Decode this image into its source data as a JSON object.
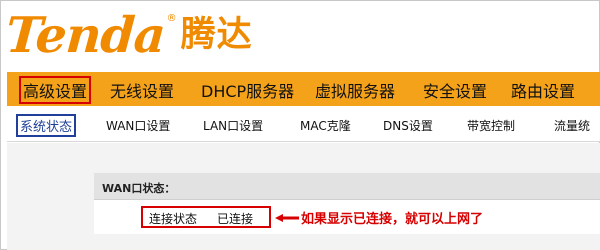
{
  "logo": {
    "brand_en": "Tenda",
    "registered": "®",
    "brand_cn": "腾达"
  },
  "main_nav": {
    "items": [
      {
        "label": "高级设置",
        "active": true
      },
      {
        "label": "无线设置",
        "active": false
      },
      {
        "label": "DHCP服务器",
        "active": false
      },
      {
        "label": "虚拟服务器",
        "active": false
      },
      {
        "label": "安全设置",
        "active": false
      },
      {
        "label": "路由设置",
        "active": false
      }
    ]
  },
  "sub_nav": {
    "items": [
      {
        "label": "系统状态",
        "active": true
      },
      {
        "label": "WAN口设置",
        "active": false
      },
      {
        "label": "LAN口设置",
        "active": false
      },
      {
        "label": "MAC克隆",
        "active": false
      },
      {
        "label": "DNS设置",
        "active": false
      },
      {
        "label": "带宽控制",
        "active": false
      },
      {
        "label": "流量统",
        "active": false
      }
    ]
  },
  "wan_status": {
    "title": "WAN口状态：",
    "connection_label": "连接状态",
    "connection_value": "已连接"
  },
  "annotation": {
    "text": "如果显示已连接，就可以上网了"
  },
  "colors": {
    "brand_orange": "#f08a00",
    "nav_orange": "#f5a21b",
    "highlight_red": "#d60000",
    "active_blue": "#1f3f9a"
  }
}
